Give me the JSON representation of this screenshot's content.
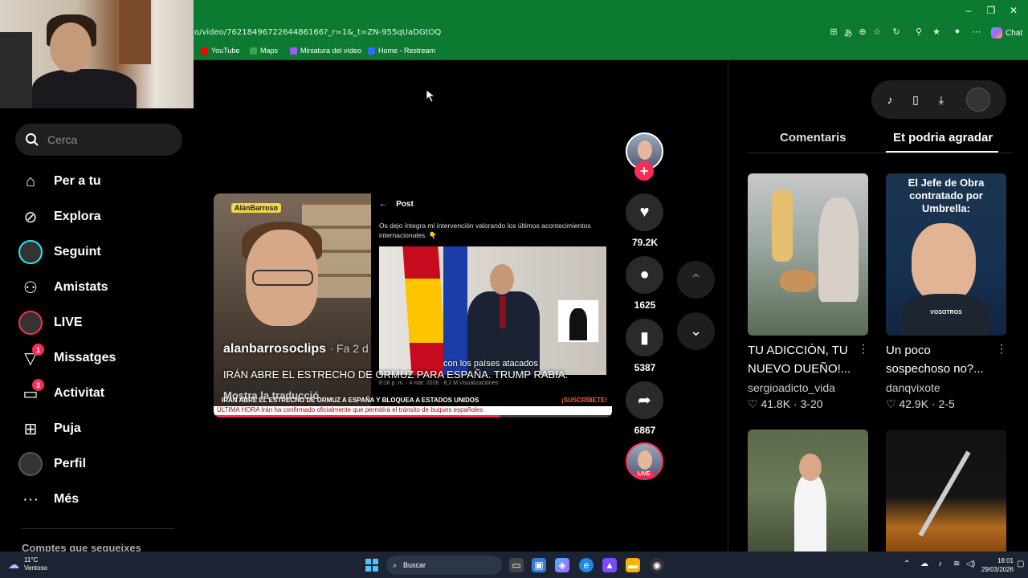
{
  "browser": {
    "url": "o/video/7621849672264486166?_r=1&_t=ZN-955qUaDGtOQ",
    "chat_label": "Chat",
    "bookmarks": [
      {
        "label": "YouTube",
        "color": "#ff0000"
      },
      {
        "label": "Maps",
        "color": "#34a853"
      },
      {
        "label": "Miniatura del vídeo",
        "color": "#9b5cff"
      },
      {
        "label": "Home - Restream",
        "color": "#2d6bff"
      }
    ]
  },
  "sidebar": {
    "search_placeholder": "Cerca",
    "items": [
      {
        "label": "Per a tu",
        "icon": "home-icon"
      },
      {
        "label": "Explora",
        "icon": "compass-icon"
      },
      {
        "label": "Seguint",
        "icon": "following-avatar-icon"
      },
      {
        "label": "Amistats",
        "icon": "friends-icon"
      },
      {
        "label": "LIVE",
        "icon": "live-icon"
      },
      {
        "label": "Missatges",
        "icon": "messages-icon",
        "badge": "1"
      },
      {
        "label": "Activitat",
        "icon": "activity-icon",
        "badge": "3"
      },
      {
        "label": "Puja",
        "icon": "upload-icon"
      },
      {
        "label": "Perfil",
        "icon": "profile-icon"
      },
      {
        "label": "Més",
        "icon": "more-icon"
      }
    ],
    "following_heading": "Comptes que segueixes"
  },
  "video": {
    "tag": "AlánBarroso",
    "post_header": "Post",
    "post_text": "Os dejo íntegra mi intervención valorando los últimos acontecimientos internacionales. 👇",
    "post_meta": "8:16 p. m. · 4 mar. 2026 · 8,2 M Visualizaciones",
    "subtitle": "con los países atacados",
    "username": "alanbarrosoclips",
    "ago": "· Fa 2 d",
    "title": "IRÁN ABRE EL ESTRECHO DE ORMUZ PARA ESPAÑA. TRUMP RABIA.",
    "translate": "Mostra la traducció",
    "banner": "IRÁN ABRE EL ESTRECHO DE ORMUZ A ESPAÑA Y BLOQUEA A ESTADOS UNIDOS",
    "subscribe": "¡SUSCRÍBETE!",
    "ticker": "ÚLTIMA HORA Irán ha confirmado oficialmente que permitirá el tránsito de buques españoles",
    "progress": 0.72
  },
  "actions": {
    "likes": "79.2K",
    "comments": "1625",
    "saves": "5387",
    "shares": "6867",
    "live_label": "LIVE"
  },
  "right_panel": {
    "tabs": [
      "Comentaris",
      "Et podria agradar"
    ],
    "videos": [
      {
        "title": "TU ADICCIÓN, TU NUEVO DUEÑO!...",
        "user": "sergioadicto_vida",
        "likes": "41.8K",
        "date": "3-20",
        "overlay": ""
      },
      {
        "title": "Un poco sospechoso no?...",
        "user": "danqvixote",
        "likes": "42.9K",
        "date": "2-5",
        "overlay": "El Jefe de Obra contratado por Umbrella:"
      }
    ],
    "thumb_caption": "VOSOTROS"
  },
  "taskbar": {
    "temp": "11°C",
    "weather": "Ventoso",
    "search": "Buscar",
    "time": "18:01",
    "date": "29/03/2026"
  }
}
